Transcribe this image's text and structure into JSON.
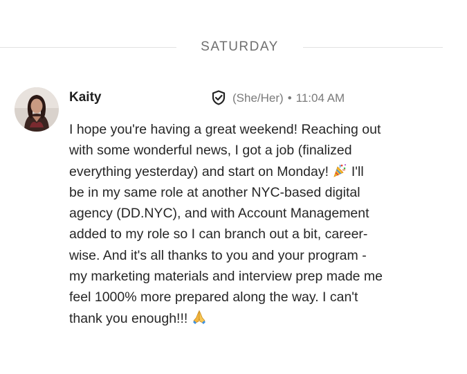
{
  "divider": {
    "label": "SATURDAY"
  },
  "message": {
    "sender": "Kaity",
    "pronouns": "(She/Her)",
    "separator": "•",
    "time": "11:04 AM",
    "lines": [
      "I hope you're having a great weekend! Reaching out",
      "with some wonderful news, I got a job (finalized",
      "everything yesterday) and start on Monday!",
      "I'll",
      "be in my same role at another NYC-based digital",
      "agency (DD.NYC), and with Account Management",
      "added to my role so I can branch out a bit, career-",
      "wise. And it's all thanks to you and your program -",
      "my marketing materials and interview prep made me",
      "feel 1000% more prepared along the way. I can't",
      "thank you enough!!!"
    ],
    "emojis": [
      "party-popper-icon",
      "folded-hands-icon"
    ]
  },
  "colors": {
    "text": "#262626",
    "meta": "#7a7a7a",
    "divider_line": "#e2e2e2"
  }
}
